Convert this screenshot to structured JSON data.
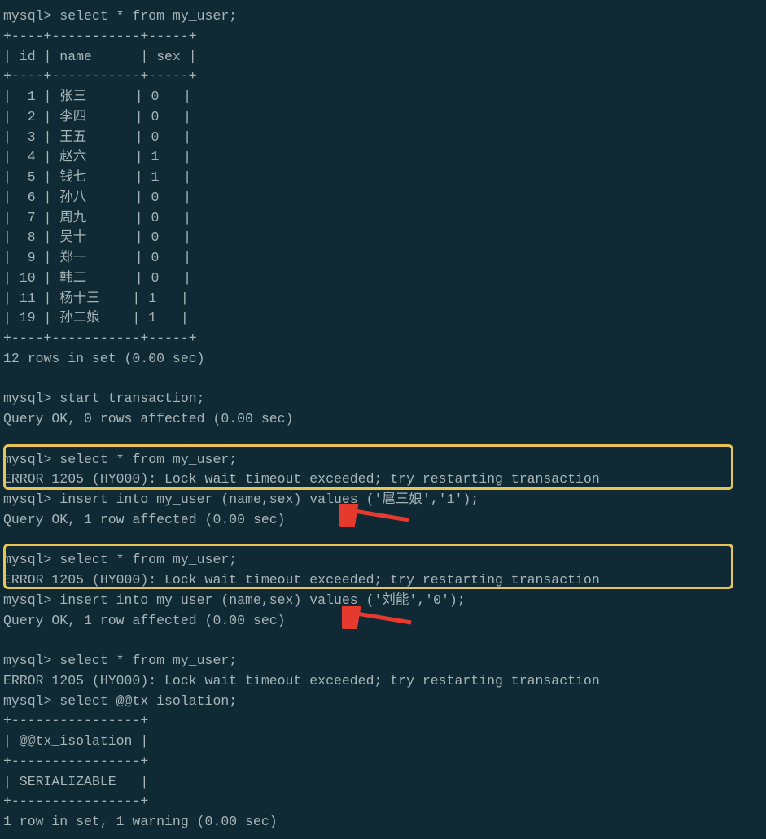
{
  "prompt_select1": "mysql> select * from my_user;",
  "border_top": "+----+-----------+-----+",
  "header_row": "| id | name      | sex |",
  "border_mid": "+----+-----------+-----+",
  "rows": [
    "|  1 | 张三      | 0   |",
    "|  2 | 李四      | 0   |",
    "|  3 | 王五      | 0   |",
    "|  4 | 赵六      | 1   |",
    "|  5 | 钱七      | 1   |",
    "|  6 | 孙八      | 0   |",
    "|  7 | 周九      | 0   |",
    "|  8 | 吴十      | 0   |",
    "|  9 | 郑一      | 0   |",
    "| 10 | 韩二      | 0   |",
    "| 11 | 杨十三    | 1   |",
    "| 19 | 孙二娘    | 1   |"
  ],
  "border_bot": "+----+-----------+-----+",
  "rows_in_set": "12 rows in set (0.00 sec)",
  "blank": " ",
  "prompt_starttx": "mysql> start transaction;",
  "query_ok0": "Query OK, 0 rows affected (0.00 sec)",
  "prompt_select2": "mysql> select * from my_user;",
  "error1": "ERROR 1205 (HY000): Lock wait timeout exceeded; try restarting transaction",
  "prompt_insert1": "mysql> insert into my_user (name,sex) values ('扈三娘','1');",
  "query_ok1": "Query OK, 1 row affected (0.00 sec)",
  "prompt_select3": "mysql> select * from my_user;",
  "error2": "ERROR 1205 (HY000): Lock wait timeout exceeded; try restarting transaction",
  "prompt_insert2": "mysql> insert into my_user (name,sex) values ('刘能','0');",
  "query_ok2": "Query OK, 1 row affected (0.00 sec)",
  "prompt_select4": "mysql> select * from my_user;",
  "error3": "ERROR 1205 (HY000): Lock wait timeout exceeded; try restarting transaction",
  "prompt_iso": "mysql> select @@tx_isolation;",
  "iso_border": "+----------------+",
  "iso_header": "| @@tx_isolation |",
  "iso_value": "| SERIALIZABLE   |",
  "iso_rows": "1 row in set, 1 warning (0.00 sec)"
}
